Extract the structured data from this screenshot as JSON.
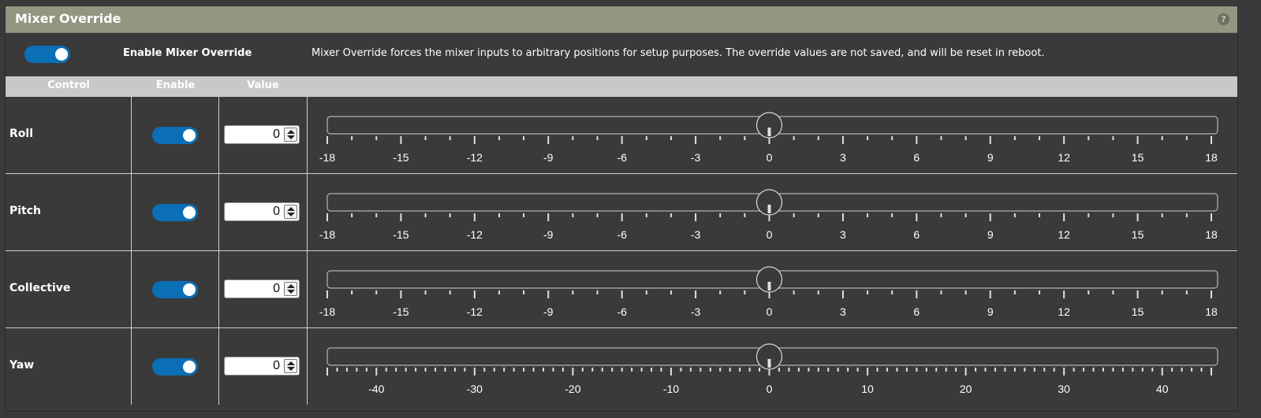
{
  "panel": {
    "title": "Mixer Override",
    "help_icon": "help-icon"
  },
  "master": {
    "enabled": true,
    "label": "Enable Mixer Override",
    "description": "Mixer Override forces the mixer inputs to arbitrary positions for setup purposes. The override values are not saved, and will be reset in reboot."
  },
  "table": {
    "headers": [
      "Control",
      "Enable",
      "Value"
    ],
    "rows": [
      {
        "label": "Roll",
        "enabled": true,
        "value": "0",
        "slider": {
          "min": -18,
          "max": 18,
          "value": 0,
          "labels": [
            -18,
            -15,
            -12,
            -9,
            -6,
            -3,
            0,
            3,
            6,
            9,
            12,
            15,
            18
          ],
          "minor_step": 1
        }
      },
      {
        "label": "Pitch",
        "enabled": true,
        "value": "0",
        "slider": {
          "min": -18,
          "max": 18,
          "value": 0,
          "labels": [
            -18,
            -15,
            -12,
            -9,
            -6,
            -3,
            0,
            3,
            6,
            9,
            12,
            15,
            18
          ],
          "minor_step": 1
        }
      },
      {
        "label": "Collective",
        "enabled": true,
        "value": "0",
        "slider": {
          "min": -18,
          "max": 18,
          "value": 0,
          "labels": [
            -18,
            -15,
            -12,
            -9,
            -6,
            -3,
            0,
            3,
            6,
            9,
            12,
            15,
            18
          ],
          "minor_step": 1
        }
      },
      {
        "label": "Yaw",
        "enabled": true,
        "value": "0",
        "slider": {
          "min": -45,
          "max": 45,
          "value": 0,
          "labels": [
            -40,
            -30,
            -20,
            -10,
            0,
            10,
            20,
            30,
            40
          ],
          "minor_step": 1
        }
      }
    ]
  },
  "colors": {
    "header_bg": "#939681",
    "toggle_on": "#0a6fb5",
    "panel_bg": "#3a3a3a"
  }
}
